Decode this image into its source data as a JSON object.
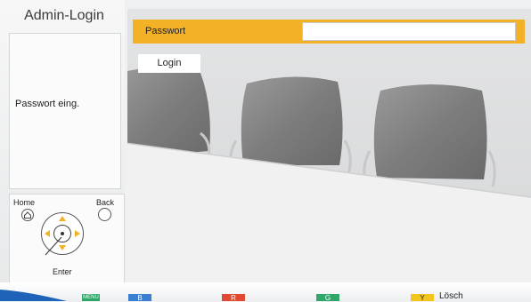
{
  "sidebar": {
    "title": "Admin-Login",
    "message": "Passwort eing."
  },
  "remote": {
    "home_label": "Home",
    "back_label": "Back",
    "enter_label": "Enter"
  },
  "form": {
    "password_label": "Passwort",
    "password_value": "",
    "login_label": "Login"
  },
  "footer": {
    "menu_label": "MENU",
    "b_label": "B",
    "r_label": "R",
    "g_label": "G",
    "y_label": "Y",
    "y_action": "Lösch"
  },
  "colors": {
    "accent": "#f2b127",
    "green_key": "#2fa66a",
    "blue_key": "#3a7fd0",
    "red_key": "#e04a33",
    "yellow_key": "#f2c51b"
  }
}
